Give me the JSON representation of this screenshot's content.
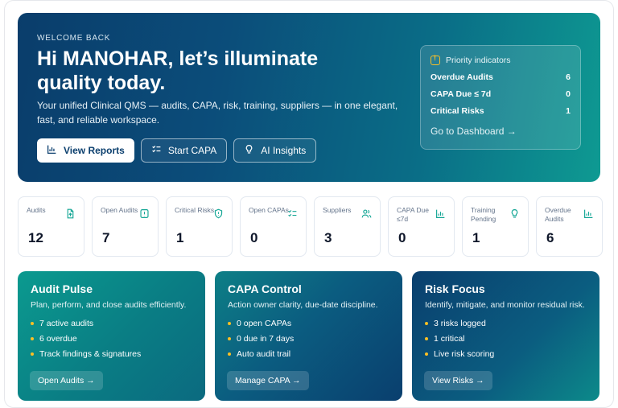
{
  "hero": {
    "eyebrow": "WELCOME BACK",
    "headline": "Hi MANOHAR, let’s illuminate quality today.",
    "subtitle": "Your unified Clinical QMS — audits, CAPA, risk, training, suppliers — in one elegant, fast, and reliable workspace.",
    "buttons": {
      "reports": "View Reports",
      "capa": "Start CAPA",
      "ai": "AI Insights"
    }
  },
  "priority": {
    "title": "Priority indicators",
    "rows": [
      {
        "label": "Overdue Audits",
        "value": "6"
      },
      {
        "label": "CAPA Due ≤ 7d",
        "value": "0"
      },
      {
        "label": "Critical Risks",
        "value": "1"
      }
    ],
    "link": "Go to Dashboard →"
  },
  "stats": [
    {
      "label": "Audits",
      "value": "12",
      "icon": "file-upload-icon"
    },
    {
      "label": "Open Audits",
      "value": "7",
      "icon": "alert-file-icon"
    },
    {
      "label": "Critical Risks",
      "value": "1",
      "icon": "shield-icon"
    },
    {
      "label": "Open CAPAs",
      "value": "0",
      "icon": "checklist-icon"
    },
    {
      "label": "Suppliers",
      "value": "3",
      "icon": "users-icon"
    },
    {
      "label": "CAPA Due ≤7d",
      "value": "0",
      "icon": "bar-chart-icon"
    },
    {
      "label": "Training Pending",
      "value": "1",
      "icon": "lightbulb-icon"
    },
    {
      "label": "Overdue Audits",
      "value": "6",
      "icon": "bar-chart-icon"
    }
  ],
  "cards": [
    {
      "title": "Audit Pulse",
      "subtitle": "Plan, perform, and close audits efficiently.",
      "items": [
        "7 active audits",
        "6 overdue",
        "Track findings & signatures"
      ],
      "button": "Open Audits →"
    },
    {
      "title": "CAPA Control",
      "subtitle": "Action owner clarity, due-date discipline.",
      "items": [
        "0 open CAPAs",
        "0 due in 7 days",
        "Auto audit trail"
      ],
      "button": "Manage CAPA →"
    },
    {
      "title": "Risk Focus",
      "subtitle": "Identify, mitigate, and monitor residual risk.",
      "items": [
        "3 risks logged",
        "1 critical",
        "Live risk scoring"
      ],
      "button": "View Risks →"
    }
  ]
}
